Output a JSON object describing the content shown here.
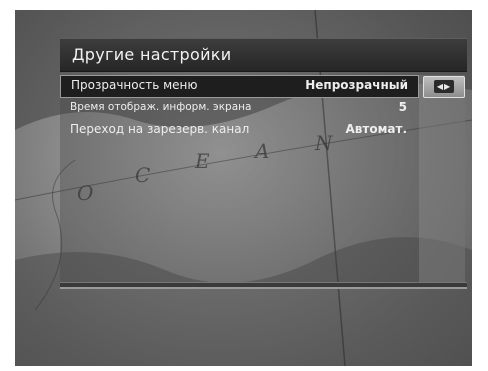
{
  "menu": {
    "title": "Другие настройки",
    "items": [
      {
        "label": "Прозрачность меню",
        "value": "Непрозрачный",
        "selected": true
      },
      {
        "label": "Время отображ. информ. экрана",
        "value": "5",
        "selected": false
      },
      {
        "label": "Переход на зарезерв. канал",
        "value": "Автомат.",
        "selected": false
      }
    ],
    "adjust_icon": "left-right-arrows-icon"
  },
  "background": {
    "map_letters": [
      "O",
      "C",
      "E",
      "A",
      "N"
    ]
  }
}
